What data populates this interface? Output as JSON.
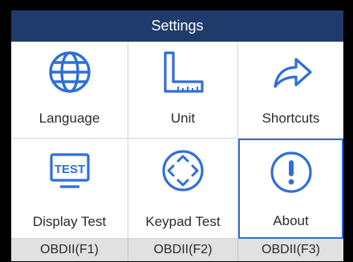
{
  "title": "Settings",
  "accent_color": "#2f6fd6",
  "titlebar_color": "#1f3b6b",
  "tiles": [
    {
      "label": "Language",
      "icon": "globe-icon"
    },
    {
      "label": "Unit",
      "icon": "ruler-icon"
    },
    {
      "label": "Shortcuts",
      "icon": "share-arrow-icon"
    },
    {
      "label": "Display Test",
      "icon": "display-test-icon",
      "icon_text": "TEST"
    },
    {
      "label": "Keypad Test",
      "icon": "keypad-icon"
    },
    {
      "label": "About",
      "icon": "info-exclamation-icon",
      "selected": true
    }
  ],
  "footer": [
    {
      "label": "OBDII(F1)"
    },
    {
      "label": "OBDII(F2)"
    },
    {
      "label": "OBDII(F3)"
    }
  ]
}
